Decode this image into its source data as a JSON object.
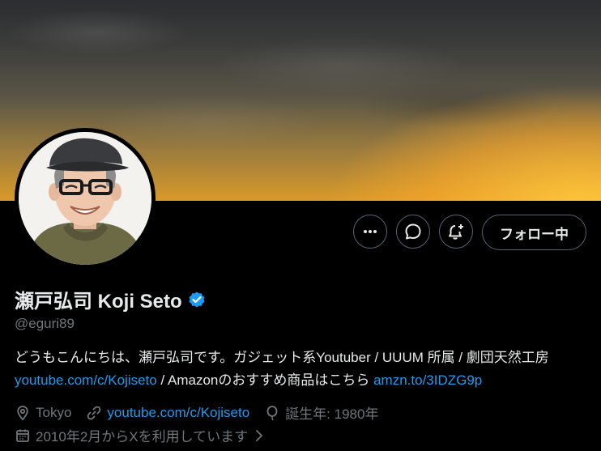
{
  "profile": {
    "display_name": "瀬戸弘司 Koji Seto",
    "handle": "@eguri89",
    "verified_icon": "verified-badge-icon",
    "bio": {
      "text_1": "どうもこんにちは、瀬戸弘司です。ガジェット系Youtuber / UUUM 所属 / 劇団天然工房 ",
      "link_1": "youtube.com/c/Kojiseto",
      "text_2": " / Amazonのおすすめ商品はこちら ",
      "link_2": "amzn.to/3IDZG9p"
    },
    "location": "Tokyo",
    "website": "youtube.com/c/Kojiseto",
    "birthday": "誕生年: 1980年",
    "joined": "2010年2月からXを利用しています"
  },
  "actions": {
    "more_icon": "more-icon",
    "message_icon": "message-icon",
    "notify_icon": "bell-plus-icon",
    "follow_label": "フォロー中"
  },
  "colors": {
    "background": "#000000",
    "text": "#e7e9ea",
    "muted": "#71767b",
    "link": "#1d9bf0",
    "verified": "#1d9bf0",
    "button_border": "#536471"
  }
}
